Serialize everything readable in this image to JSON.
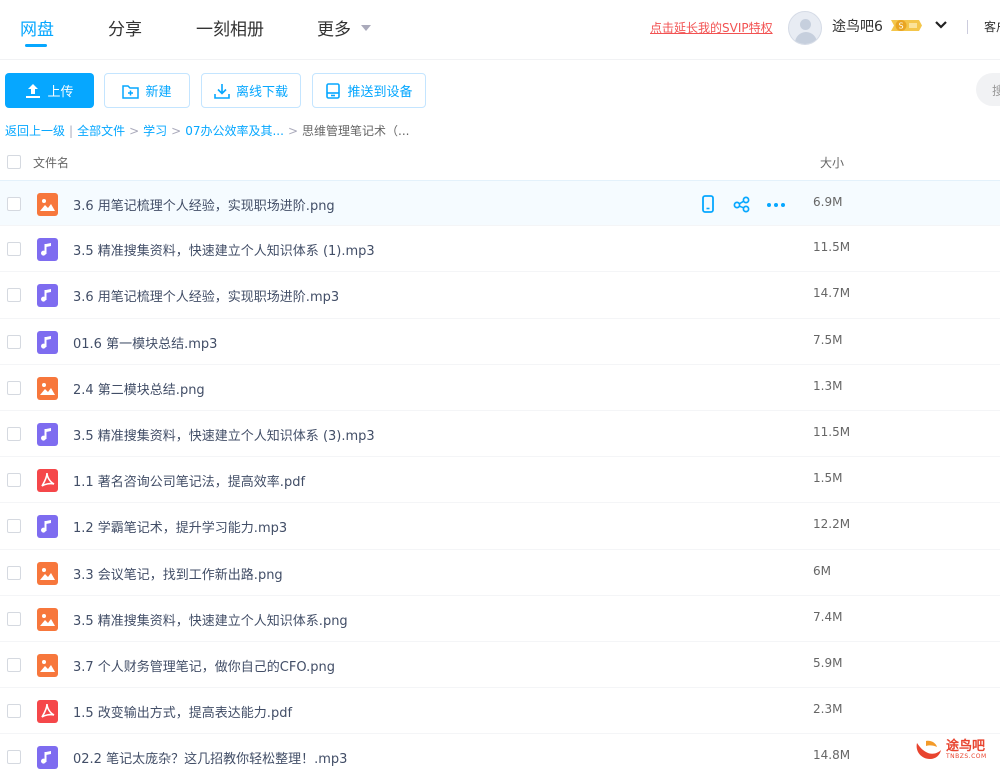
{
  "nav": {
    "tabs": [
      {
        "label": "网盘",
        "active": true
      },
      {
        "label": "分享",
        "active": false
      },
      {
        "label": "一刻相册",
        "active": false
      },
      {
        "label": "更多",
        "active": false
      }
    ],
    "svip_link": "点击延长我的SVIP特权",
    "username": "途鸟吧6",
    "vip_badge_text": "S",
    "service_text": "客户"
  },
  "toolbar": {
    "upload": "上传",
    "new": "新建",
    "offline_download": "离线下载",
    "push_to_device": "推送到设备",
    "search_placeholder": "搜"
  },
  "breadcrumb": {
    "back": "返回上一级",
    "all_files": "全部文件",
    "level1": "学习",
    "level2": "07办公效率及其...",
    "current": "思维管理笔记术（..."
  },
  "table": {
    "col_name": "文件名",
    "col_size": "大小",
    "rows": [
      {
        "name": "3.6 用笔记梳理个人经验，实现职场进阶.png",
        "size": "6.9M",
        "type": "image"
      },
      {
        "name": "3.5 精准搜集资料，快速建立个人知识体系 (1).mp3",
        "size": "11.5M",
        "type": "audio"
      },
      {
        "name": "3.6 用笔记梳理个人经验，实现职场进阶.mp3",
        "size": "14.7M",
        "type": "audio"
      },
      {
        "name": "01.6 第一模块总结.mp3",
        "size": "7.5M",
        "type": "audio"
      },
      {
        "name": "2.4 第二模块总结.png",
        "size": "1.3M",
        "type": "image"
      },
      {
        "name": "3.5 精准搜集资料，快速建立个人知识体系 (3).mp3",
        "size": "11.5M",
        "type": "audio"
      },
      {
        "name": "1.1 著名咨询公司笔记法，提高效率.pdf",
        "size": "1.5M",
        "type": "pdf"
      },
      {
        "name": "1.2 学霸笔记术，提升学习能力.mp3",
        "size": "12.2M",
        "type": "audio"
      },
      {
        "name": "3.3 会议笔记，找到工作新出路.png",
        "size": "6M",
        "type": "image"
      },
      {
        "name": "3.5 精准搜集资料，快速建立个人知识体系.png",
        "size": "7.4M",
        "type": "image"
      },
      {
        "name": "3.7 个人财务管理笔记，做你自己的CFO.png",
        "size": "5.9M",
        "type": "image"
      },
      {
        "name": "1.5 改变输出方式，提高表达能力.pdf",
        "size": "2.3M",
        "type": "pdf"
      },
      {
        "name": "02.2 笔记太庞杂？这几招教你轻松整理！.mp3",
        "size": "14.8M",
        "type": "audio"
      }
    ]
  },
  "watermark": {
    "text": "途鸟吧",
    "sub": "TNBZS.COM"
  },
  "colors": {
    "accent": "#06a7ff",
    "image_icon": "#f7773c",
    "audio_icon": "#7e6cf0",
    "pdf_icon": "#f5474a",
    "svip": "#f25252"
  },
  "icons": {
    "upload": "upload-icon",
    "new": "new-folder-icon",
    "download": "download-icon",
    "device": "device-icon",
    "row_actions": [
      "phone-icon",
      "share-icon",
      "more-icon"
    ]
  }
}
